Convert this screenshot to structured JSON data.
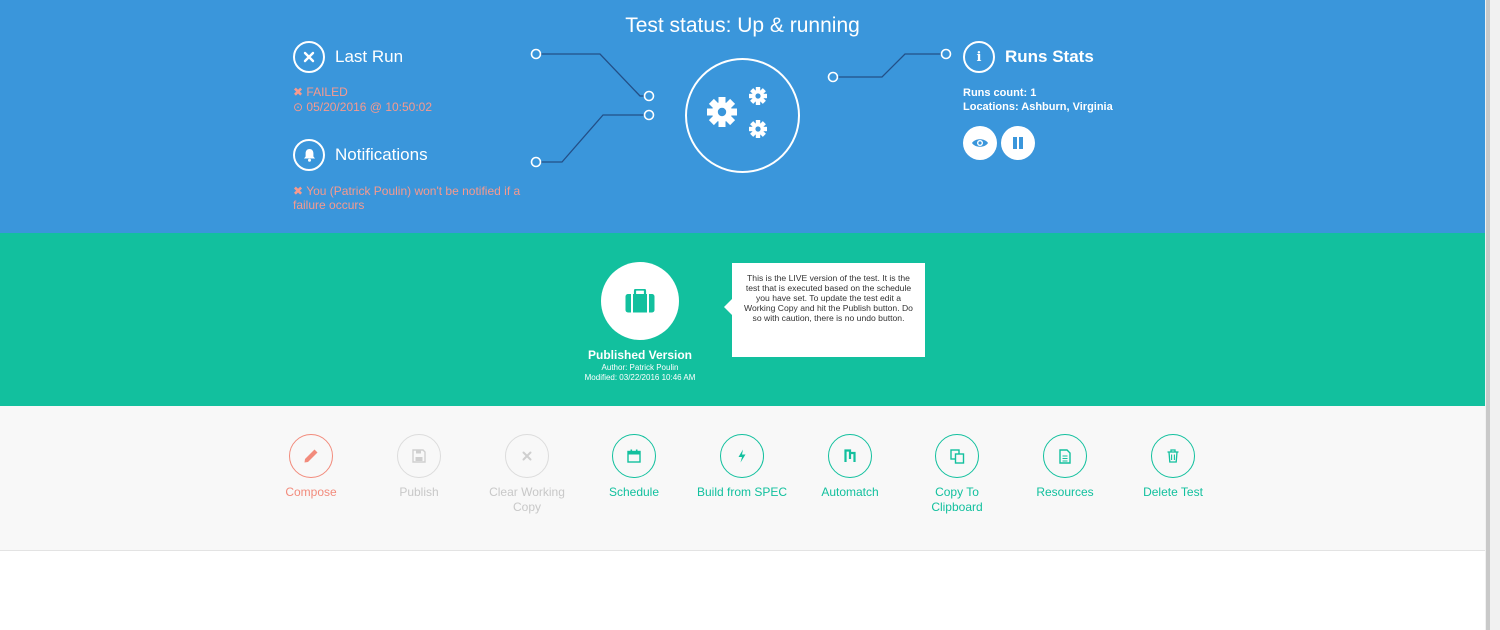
{
  "header": {
    "status_title": "Test status: Up & running"
  },
  "last_run": {
    "title": "Last Run",
    "result": "FAILED",
    "timestamp": "05/20/2016 @ 10:50:02",
    "icon": "times-icon"
  },
  "notifications": {
    "title": "Notifications",
    "message": "You (Patrick Poulin) won't be notified if a failure occurs",
    "icon": "bell-icon"
  },
  "runs_stats": {
    "title": "Runs Stats",
    "runs_count": "Runs count: 1",
    "locations": "Locations: Ashburn, Virginia",
    "icon": "info-icon",
    "buttons": [
      "eye-icon",
      "pause-icon"
    ]
  },
  "published_version": {
    "title": "Published Version",
    "author": "Author: Patrick Poulin",
    "modified": "Modified: 03/22/2016 10:46 AM",
    "tooltip": "This is the LIVE version of the test. It is the test that is executed based on the schedule you have set. To update the test edit a Working Copy and hit the Publish button. Do so with caution, there is no undo button."
  },
  "actions": [
    {
      "label": "Compose",
      "state": "active-red",
      "icon": "pencil-icon"
    },
    {
      "label": "Publish",
      "state": "disabled",
      "icon": "save-icon"
    },
    {
      "label": "Clear Working Copy",
      "state": "disabled",
      "icon": "times-icon"
    },
    {
      "label": "Schedule",
      "state": "enabled",
      "icon": "calendar-icon"
    },
    {
      "label": "Build from SPEC",
      "state": "enabled",
      "icon": "bolt-icon"
    },
    {
      "label": "Automatch",
      "state": "enabled",
      "icon": "automatch-icon"
    },
    {
      "label": "Copy To Clipboard",
      "state": "enabled",
      "icon": "copy-icon"
    },
    {
      "label": "Resources",
      "state": "enabled",
      "icon": "file-icon"
    },
    {
      "label": "Delete Test",
      "state": "enabled",
      "icon": "trash-icon"
    }
  ],
  "colors": {
    "hero_bg": "#3a96db",
    "version_bg": "#12c09e",
    "error_text": "#f79a8e",
    "accent": "#12c09e",
    "danger": "#f28b7c"
  }
}
